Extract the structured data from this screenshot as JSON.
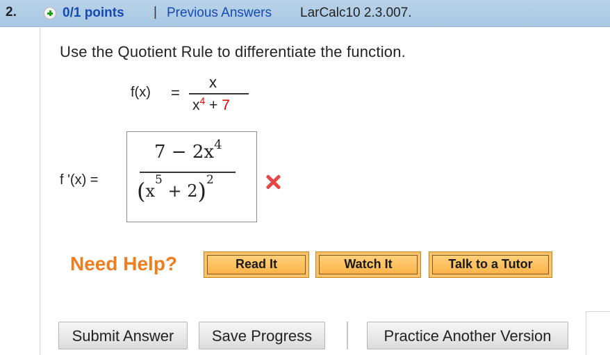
{
  "header": {
    "question_number": "2.",
    "points": "0/1 points",
    "separator": "|",
    "previous_answers": "Previous Answers",
    "problem_code": "LarCalc10 2.3.007."
  },
  "question": {
    "prompt": "Use the Quotient Rule to differentiate the function.",
    "function": {
      "label": "f(x)",
      "equals": "=",
      "numerator": "x",
      "denominator_base": "x",
      "denominator_exponent": "4",
      "denominator_rest": " + ",
      "denominator_constant": "7"
    }
  },
  "answer": {
    "label": "f '(x) =",
    "numerator_main": "7 − 2x",
    "numerator_exponent": "4",
    "denominator_open": "(",
    "denominator_base": "x",
    "denominator_inner_exponent": "5",
    "denominator_rest": " + 2",
    "denominator_close": ")",
    "denominator_outer_exponent": "2",
    "status_icon": "incorrect-x-icon",
    "status_color": "#e44848"
  },
  "help": {
    "title": "Need Help?",
    "buttons": [
      "Read It",
      "Watch It",
      "Talk to a Tutor"
    ]
  },
  "actions": {
    "submit": "Submit Answer",
    "save": "Save Progress",
    "practice": "Practice Another Version"
  },
  "colors": {
    "header_bg": "#b9d3e9",
    "link_blue": "#1648b4",
    "help_orange": "#ee7d1e",
    "help_button_bg": "#fcc26a",
    "highlight_red": "#e00000"
  }
}
